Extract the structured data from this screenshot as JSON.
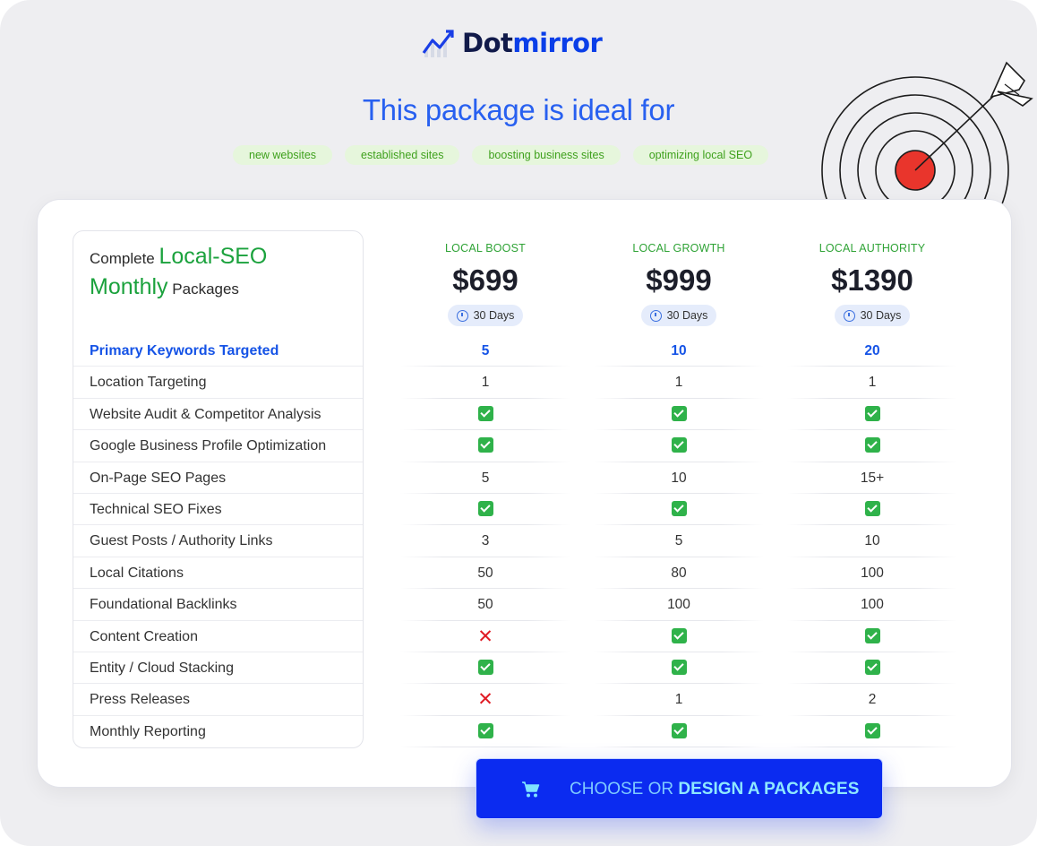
{
  "brand": {
    "name_part1": "Dot",
    "name_part2": "mirror",
    "logo_icon": "growth-chart-icon"
  },
  "headline": "This package is ideal for",
  "tags": [
    "new websites",
    "established sites",
    "boosting business sites",
    "optimizing local SEO"
  ],
  "title": {
    "part1": "Complete ",
    "highlight1": "Local-SEO",
    "highlight2": "Monthly",
    "part2": " Packages"
  },
  "plans": [
    {
      "name": "LOCAL BOOST",
      "price": "$699",
      "duration": "30 Days"
    },
    {
      "name": "LOCAL GROWTH",
      "price": "$999",
      "duration": "30 Days"
    },
    {
      "name": "LOCAL AUTHORITY",
      "price": "$1390",
      "duration": "30 Days"
    }
  ],
  "features": [
    {
      "label": "Primary Keywords Targeted",
      "values": [
        "5",
        "10",
        "20"
      ],
      "primary": true
    },
    {
      "label": "Location Targeting",
      "values": [
        "1",
        "1",
        "1"
      ]
    },
    {
      "label": "Website Audit & Competitor Analysis",
      "values": [
        "check",
        "check",
        "check"
      ]
    },
    {
      "label": "Google Business Profile Optimization",
      "values": [
        "check",
        "check",
        "check"
      ]
    },
    {
      "label": "On-Page SEO Pages",
      "values": [
        "5",
        "10",
        "15+"
      ]
    },
    {
      "label": "Technical SEO Fixes",
      "values": [
        "check",
        "check",
        "check"
      ]
    },
    {
      "label": "Guest Posts / Authority Links",
      "values": [
        "3",
        "5",
        "10"
      ]
    },
    {
      "label": "Local Citations",
      "values": [
        "50",
        "80",
        "100"
      ]
    },
    {
      "label": "Foundational Backlinks",
      "values": [
        "50",
        "100",
        "100"
      ]
    },
    {
      "label": "Content Creation",
      "values": [
        "cross",
        "check",
        "check"
      ]
    },
    {
      "label": "Entity / Cloud Stacking",
      "values": [
        "check",
        "check",
        "check"
      ]
    },
    {
      "label": "Press Releases",
      "values": [
        "cross",
        "1",
        "2"
      ]
    },
    {
      "label": "Monthly Reporting",
      "values": [
        "check",
        "check",
        "check"
      ]
    }
  ],
  "cta": {
    "part1": "CHOOSE OR ",
    "part2": "DESIGN A PACKAGES",
    "icon": "cart-icon"
  },
  "colors": {
    "accent_blue": "#0b2bf0",
    "green": "#2fb24a",
    "red": "#e01b24",
    "headline_blue": "#2860f0"
  }
}
